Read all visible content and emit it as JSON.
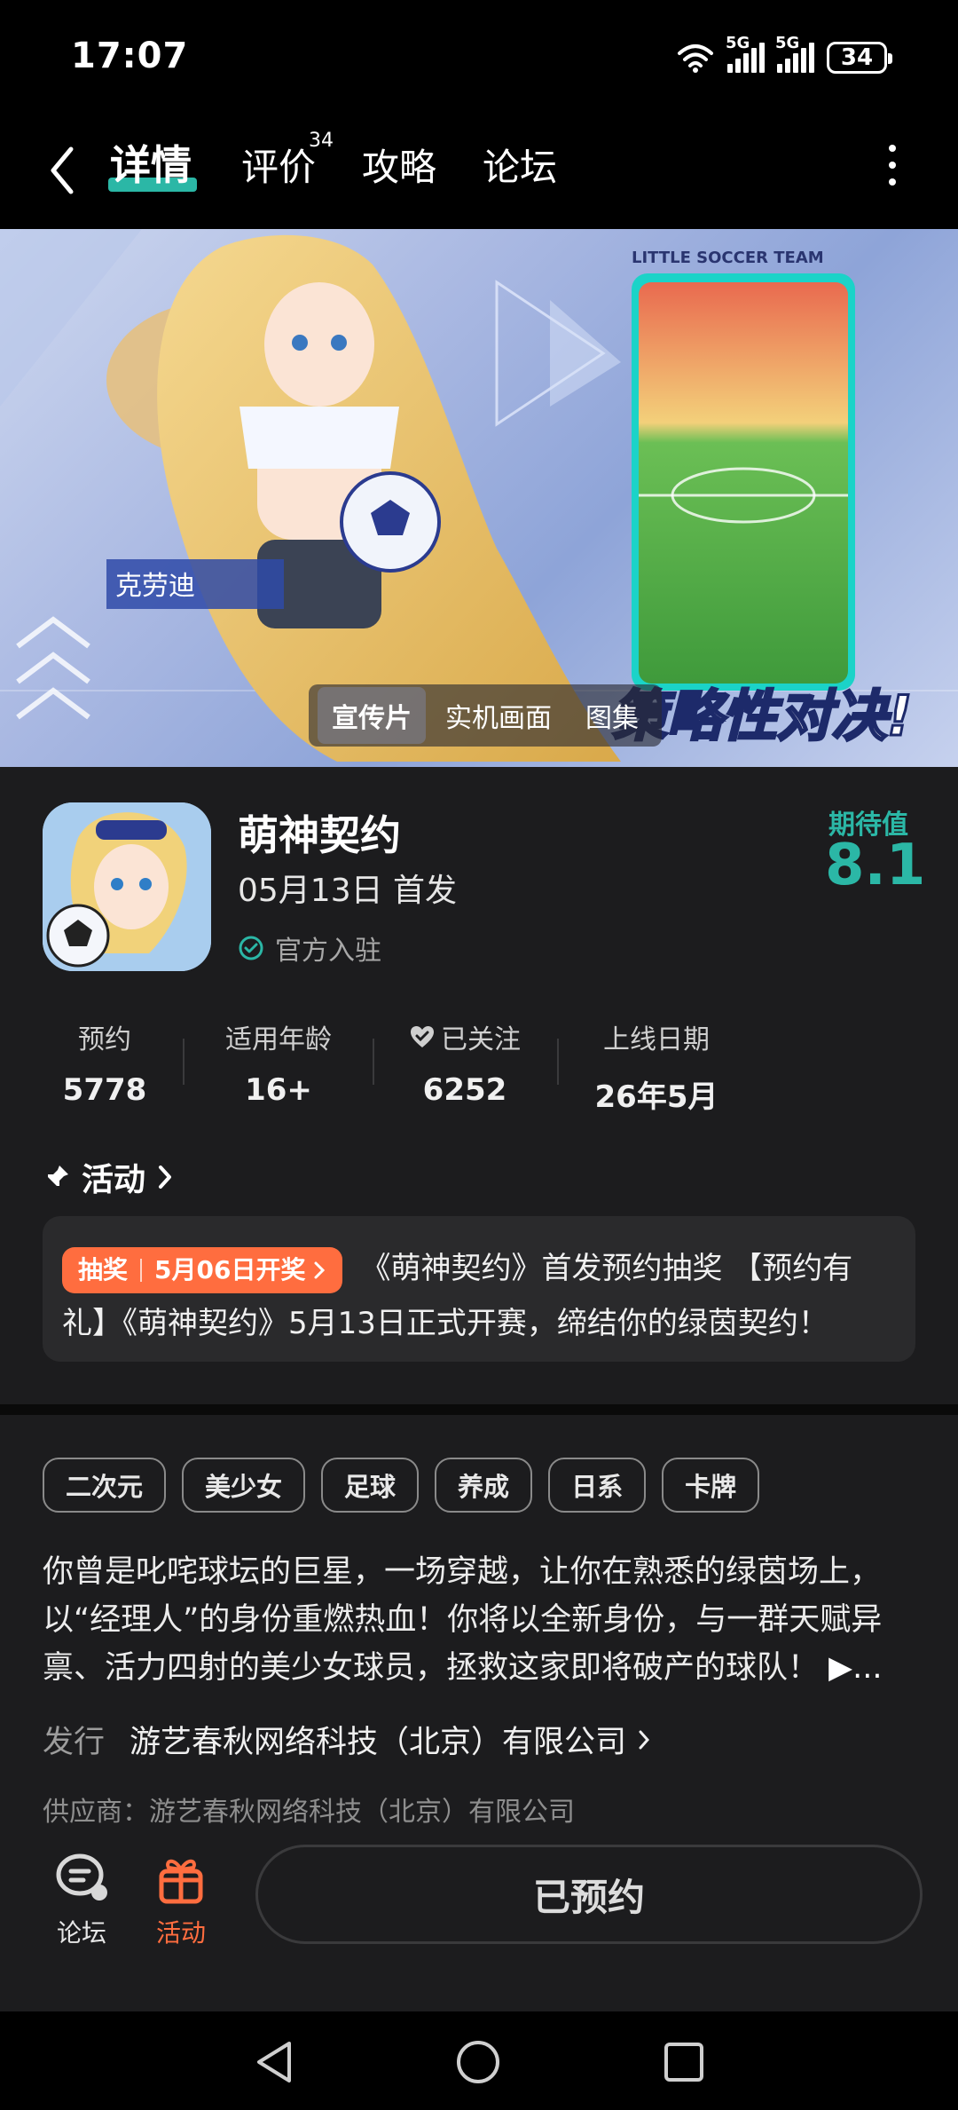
{
  "status_bar": {
    "time": "17:07",
    "network1": "5G",
    "network2": "5G",
    "battery": "34"
  },
  "nav": {
    "tabs": [
      {
        "label": "详情",
        "active": true
      },
      {
        "label": "评价",
        "count": "34"
      },
      {
        "label": "攻略"
      },
      {
        "label": "论坛"
      }
    ]
  },
  "banner": {
    "tabs": [
      {
        "label": "宣传片",
        "active": true
      },
      {
        "label": "实机画面"
      },
      {
        "label": "图集"
      }
    ],
    "overlay_text": "策略性对决!",
    "corner_text": "LITTLE SOCCER TEAM",
    "character_name": "克劳迪"
  },
  "app": {
    "name": "萌神契约",
    "release": "05月13日 首发",
    "official": "官方入驻",
    "expectation_label": "期待值",
    "expectation_value": "8.1"
  },
  "stats": [
    {
      "label": "预约",
      "value": "5778"
    },
    {
      "label": "适用年龄",
      "value": "16+"
    },
    {
      "label": "已关注",
      "value": "6252",
      "icon": "heart-icon"
    },
    {
      "label": "上线日期",
      "value": "26年5月"
    }
  ],
  "activity": {
    "title": "活动",
    "badge_type": "抽奖",
    "badge_date": "5月06日开奖",
    "text": "《萌神契约》首发预约抽奖 【预约有礼】《萌神契约》5月13日正式开赛，缔结你的绿茵契约！"
  },
  "tags": [
    "二次元",
    "美少女",
    "足球",
    "养成",
    "日系",
    "卡牌"
  ],
  "description": "你曾是叱咤球坛的巨星，一场穿越，让你在熟悉的绿茵场上，以“经理人”的身份重燃热血！你将以全新身份，与一群天赋异禀、活力四射的美少女球员，拯救这家即将破产的球队！",
  "description_more": "▶...",
  "publisher": {
    "label": "发行",
    "name": "游艺春秋网络科技（北京）有限公司"
  },
  "supplier": "供应商：游艺春秋网络科技（北京）有限公司",
  "bottom_bar": {
    "forum_label": "论坛",
    "activity_label": "活动",
    "reserve_label": "已预约",
    "accent": "#ff6d3f"
  },
  "colors": {
    "teal": "#2bb7a6",
    "orange": "#ff6d3f",
    "background": "#1c1c1e"
  }
}
